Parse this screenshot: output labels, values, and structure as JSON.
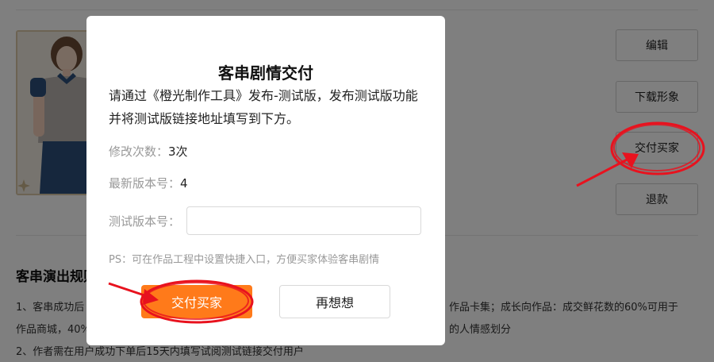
{
  "page": {
    "side_buttons": {
      "edit": "编辑",
      "download": "下载形象",
      "deliver": "交付买家",
      "refund": "退款"
    },
    "rules": {
      "title": "客串演出规则",
      "line1_left": "1、客串成功后",
      "line1_right": "作品卡集；成长向作品：成交鲜花数的60%可用于",
      "line2_left": "作品商城，40%",
      "line2_right": "的人情感划分",
      "line3": "2、作者需在用户成功下单后15天内填写试阅测试链接交付用户"
    }
  },
  "modal": {
    "title": "客串剧情交付",
    "description": "请通过《橙光制作工具》发布-测试版，发布测试版功能并将测试版链接地址填写到下方。",
    "modify_count_label": "修改次数：",
    "modify_count_value": "3次",
    "latest_version_label": "最新版本号：",
    "latest_version_value": "4",
    "test_version_label": "测试版本号：",
    "test_version_value": "",
    "test_version_placeholder": "",
    "ps_text": "PS：可在作品工程中设置快捷入口，方便买家体验客串剧情",
    "confirm_button": "交付买家",
    "cancel_button": "再想想"
  },
  "annotations": {
    "color": "#e8121e"
  },
  "colors": {
    "primary": "#ff7a1a",
    "overlay": "rgba(0,0,0,0.5)"
  }
}
